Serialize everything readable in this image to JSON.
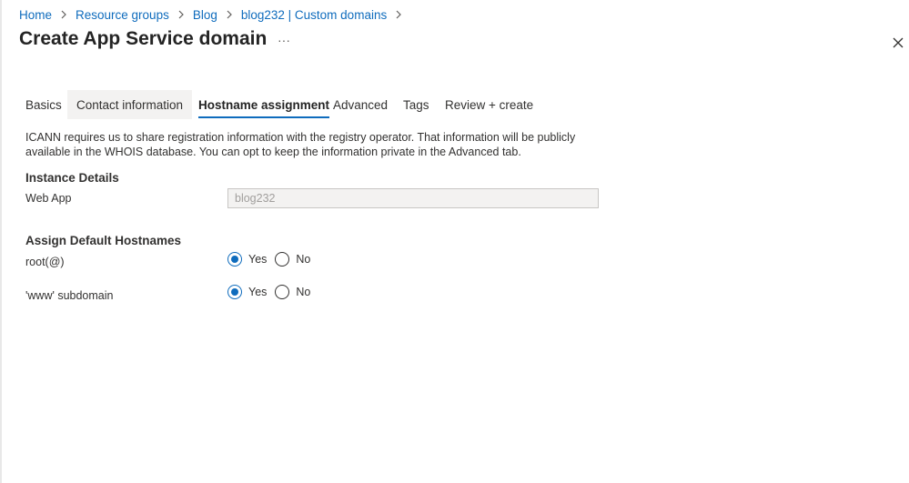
{
  "breadcrumb": {
    "items": [
      "Home",
      "Resource groups",
      "Blog",
      "blog232 | Custom domains"
    ],
    "separator_icon": "chevron-right-icon"
  },
  "header": {
    "title": "Create App Service domain",
    "more_label": "···",
    "close_icon": "close-icon"
  },
  "tabs": [
    {
      "label": "Basics",
      "state": "normal"
    },
    {
      "label": "Contact information",
      "state": "hover"
    },
    {
      "label": "Hostname assignment",
      "state": "selected"
    },
    {
      "label": "Advanced",
      "state": "normal"
    },
    {
      "label": "Tags",
      "state": "normal"
    },
    {
      "label": "Review + create",
      "state": "normal"
    }
  ],
  "info_text": "ICANN requires us to share registration information with the registry operator. That information will be publicly available in the WHOIS database. You can opt to keep the information private in the Advanced tab.",
  "instance_details": {
    "title": "Instance Details",
    "web_app_label": "Web App",
    "web_app_value": "blog232"
  },
  "assign_hostnames": {
    "title": "Assign Default Hostnames",
    "root": {
      "label": "root(@)",
      "options": [
        "Yes",
        "No"
      ],
      "selected": "Yes"
    },
    "www": {
      "label": "'www' subdomain",
      "options": [
        "Yes",
        "No"
      ],
      "selected": "Yes"
    }
  },
  "colors": {
    "accent": "#0f6cbd",
    "link": "#0f6cbd",
    "text": "#323130",
    "disabled_field_bg": "#f3f2f1"
  }
}
